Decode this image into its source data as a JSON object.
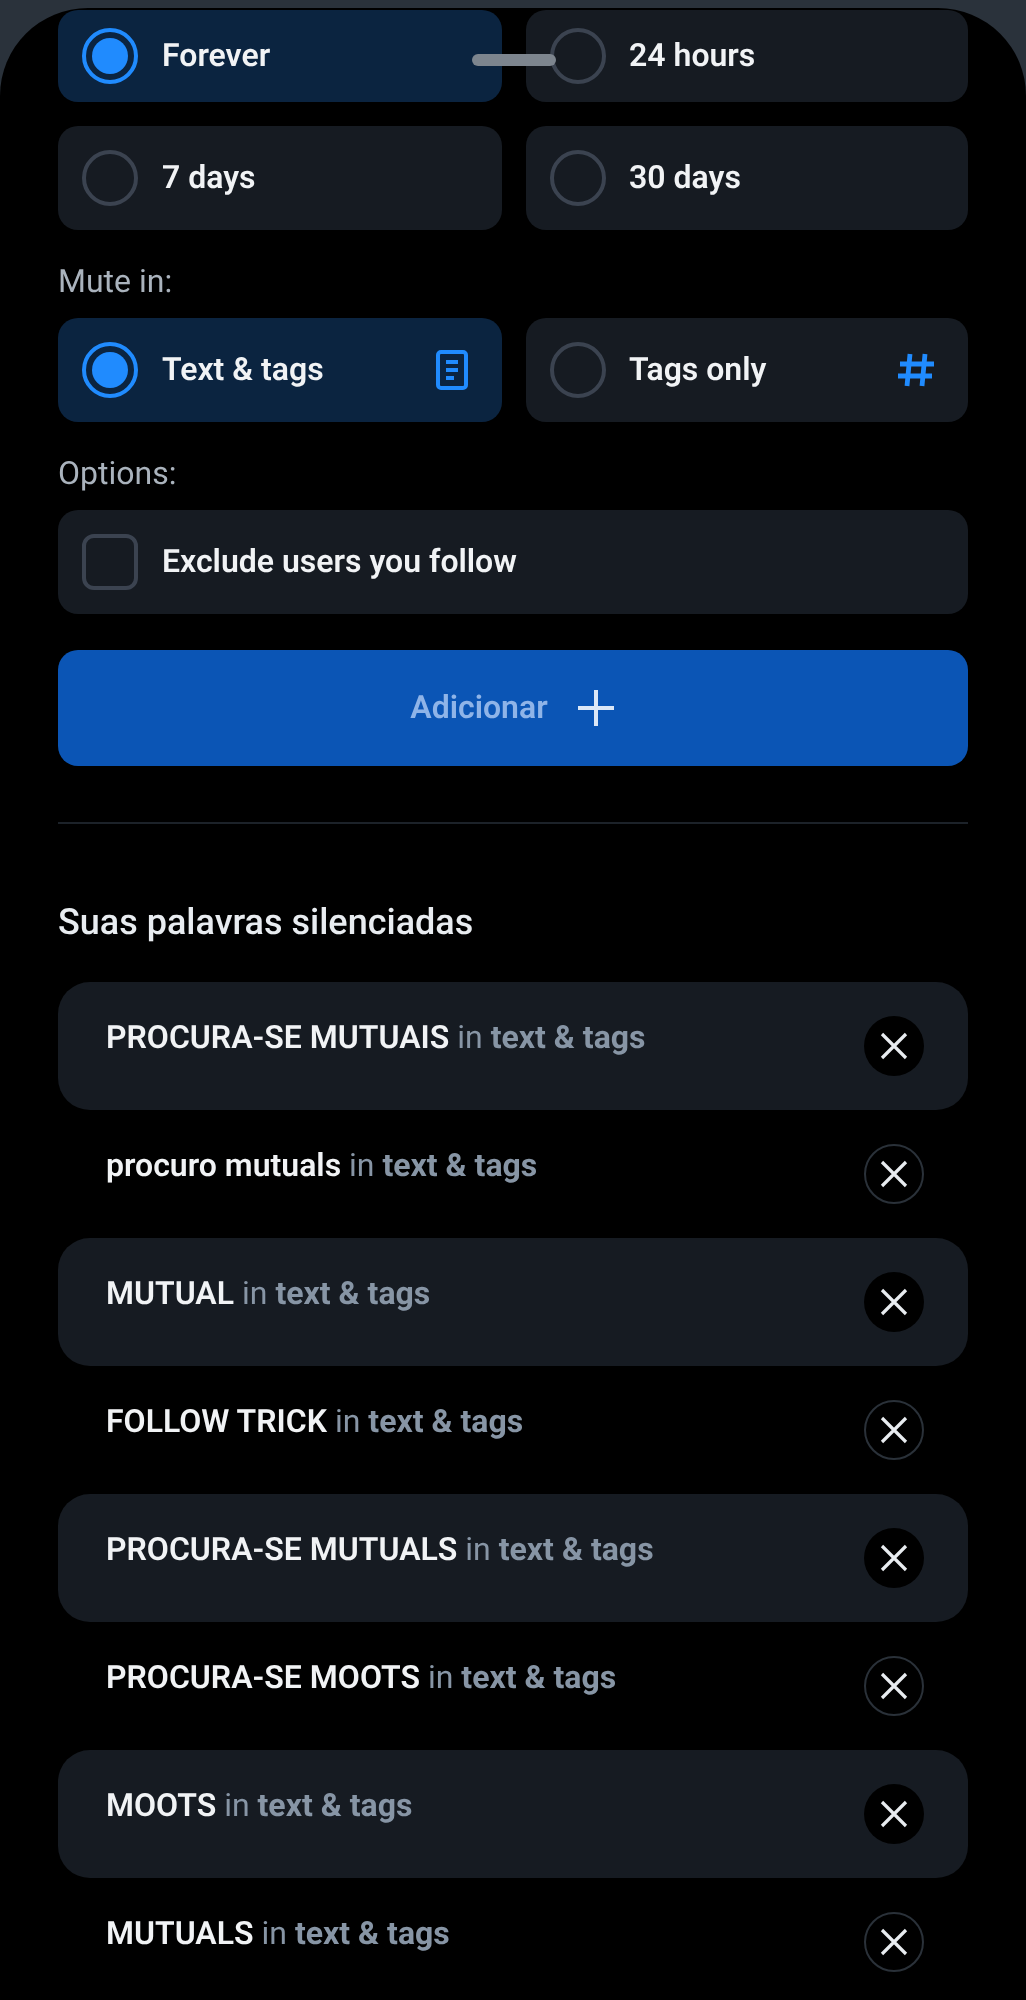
{
  "duration_options": [
    {
      "label": "Forever",
      "selected": true
    },
    {
      "label": "24 hours",
      "selected": false
    },
    {
      "label": "7 days",
      "selected": false
    },
    {
      "label": "30 days",
      "selected": false
    }
  ],
  "mute_in": {
    "label": "Mute in:",
    "options": [
      {
        "label": "Text & tags",
        "selected": true,
        "kind": "text"
      },
      {
        "label": "Tags only",
        "selected": false,
        "kind": "tags"
      }
    ]
  },
  "options": {
    "label": "Options:",
    "items": [
      {
        "label": "Exclude users you follow",
        "checked": false
      }
    ]
  },
  "add_button": {
    "label": "Adicionar"
  },
  "muted_words": {
    "title": "Suas palavras silenciadas",
    "items": [
      {
        "phrase": "PROCURA-SE MUTUAIS",
        "scope": "in **text & tags**"
      },
      {
        "phrase": "procuro mutuals",
        "scope": "in **text & tags**"
      },
      {
        "phrase": "MUTUAL",
        "scope": "in **text & tags**"
      },
      {
        "phrase": "FOLLOW TRICK",
        "scope": "in **text & tags**"
      },
      {
        "phrase": "PROCURA-SE MUTUALS",
        "scope": "in **text & tags**"
      },
      {
        "phrase": "PROCURA-SE MOOTS",
        "scope": "in **text & tags**"
      },
      {
        "phrase": "MOOTS",
        "scope": "in **text & tags**"
      },
      {
        "phrase": "MUTUALS",
        "scope": "in **text & tags**"
      }
    ]
  }
}
